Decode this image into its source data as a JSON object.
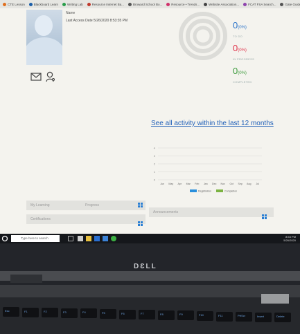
{
  "bookmarks": [
    {
      "label": "CTE Lesson",
      "color": "#e07020"
    },
    {
      "label": "Blackboard Learn",
      "color": "#1b5ea8"
    },
    {
      "label": "Writing Lab",
      "color": "#2a9d4a"
    },
    {
      "label": "Resource Internet Ba...",
      "color": "#c0392b"
    },
    {
      "label": "Broward School Bo...",
      "color": "#555555"
    },
    {
      "label": "Resource • Trends...",
      "color": "#d0306a"
    },
    {
      "label": "Website Association...",
      "color": "#444444"
    },
    {
      "label": "FCAT FSA Search...",
      "color": "#8e44ad"
    },
    {
      "label": "Gate Guides Ip...",
      "color": "#555555"
    }
  ],
  "profile": {
    "name": "Name",
    "last_access": "Last Access Date 5/26/2020 8:53:35 PM"
  },
  "stats": [
    {
      "value": "0",
      "pct": "(0%)",
      "label": "TO DO",
      "color": "#2a73c9"
    },
    {
      "value": "0",
      "pct": "(0%)",
      "label": "IN PROGRESS",
      "color": "#e0334a"
    },
    {
      "value": "0",
      "pct": "(0%)",
      "label": "COMPLETED",
      "color": "#3a9a3a"
    }
  ],
  "activity_link": "See all activity within the last 12 months",
  "chart_data": {
    "type": "bar",
    "categories": [
      "Jun",
      "May",
      "Apr",
      "Mar",
      "Feb",
      "Jan",
      "Dec",
      "Nov",
      "Oct",
      "Sep",
      "Aug",
      "Jul"
    ],
    "series": [
      {
        "name": "Registration",
        "values": [
          0,
          0,
          0,
          0,
          0,
          0,
          0,
          0,
          0,
          0,
          0,
          0
        ],
        "color": "#2a8fdc"
      },
      {
        "name": "Completion",
        "values": [
          0,
          0,
          0,
          0,
          0,
          0,
          0,
          0,
          0,
          0,
          0,
          0
        ],
        "color": "#7cb342"
      }
    ],
    "ylim": [
      0,
      4
    ],
    "yticks": [
      "4",
      "3",
      "2",
      "1",
      "0"
    ],
    "legend": "bottom",
    "grid": true
  },
  "panels": {
    "learning_label": "My Learning",
    "progress_label": "Progress",
    "announcements_label": "Announcements",
    "certifications_label": "Certifications"
  },
  "taskbar": {
    "search_placeholder": "Type here to search",
    "time": "8:53 PM",
    "date": "5/26/2020"
  },
  "brand": "DƐLL",
  "keys": [
    "Esc",
    "F1",
    "F2",
    "F3",
    "F4",
    "F5",
    "F6",
    "F7",
    "F8",
    "F9",
    "F10",
    "F11",
    "PrtScr",
    "Insert",
    "Delete"
  ]
}
